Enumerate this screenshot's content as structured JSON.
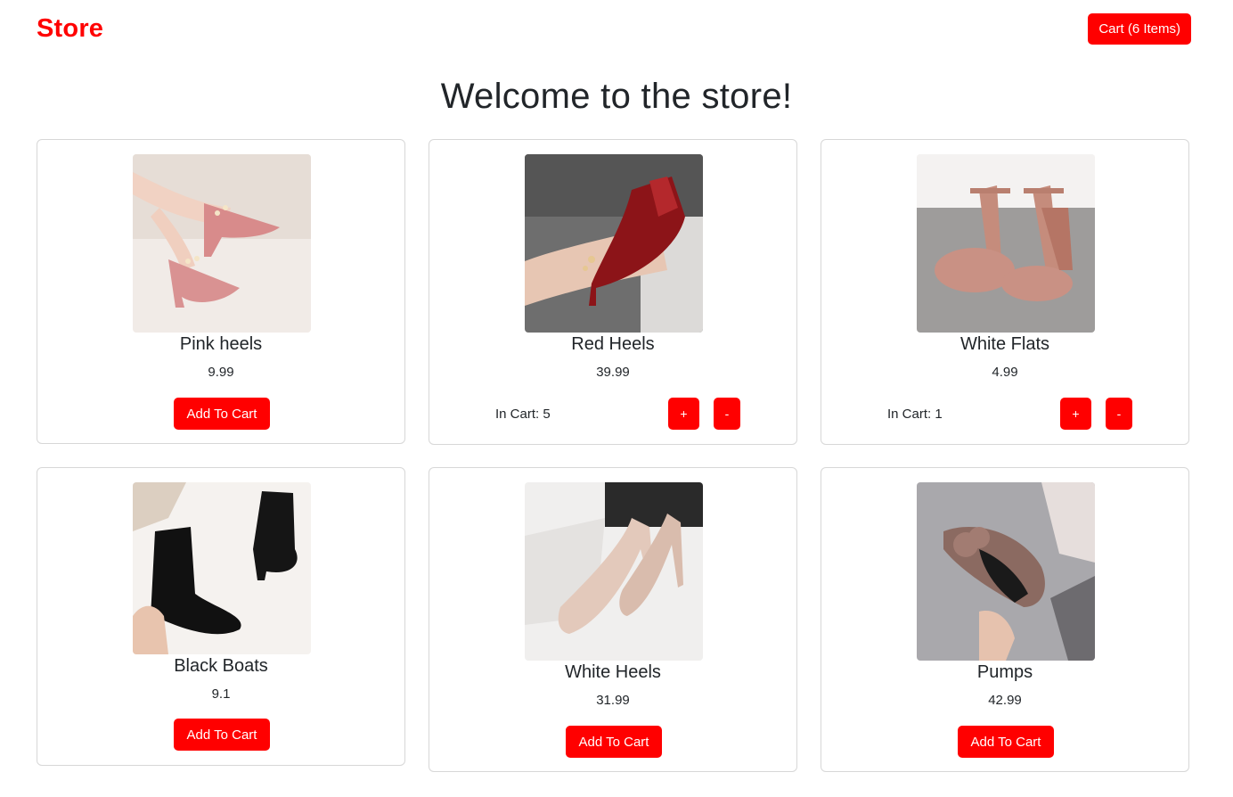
{
  "navbar": {
    "brand": "Store",
    "cart_button": "Cart (6 Items)"
  },
  "main": {
    "title": "Welcome to the store!"
  },
  "products": [
    {
      "name": "Pink heels",
      "price": "9.99",
      "in_cart": null,
      "action_label": "Add To Cart"
    },
    {
      "name": "Red Heels",
      "price": "39.99",
      "in_cart": "In Cart: 5",
      "plus_label": "+",
      "minus_label": "-"
    },
    {
      "name": "White Flats",
      "price": "4.99",
      "in_cart": "In Cart: 1",
      "plus_label": "+",
      "minus_label": "-"
    },
    {
      "name": "Black Boats",
      "price": "9.1",
      "in_cart": null,
      "action_label": "Add To Cart"
    },
    {
      "name": "White Heels",
      "price": "31.99",
      "in_cart": null,
      "action_label": "Add To Cart"
    },
    {
      "name": "Pumps",
      "price": "42.99",
      "in_cart": null,
      "action_label": "Add To Cart"
    }
  ],
  "colors": {
    "accent": "#ff0000",
    "text": "#212529",
    "card_border": "#d7d7d7"
  }
}
